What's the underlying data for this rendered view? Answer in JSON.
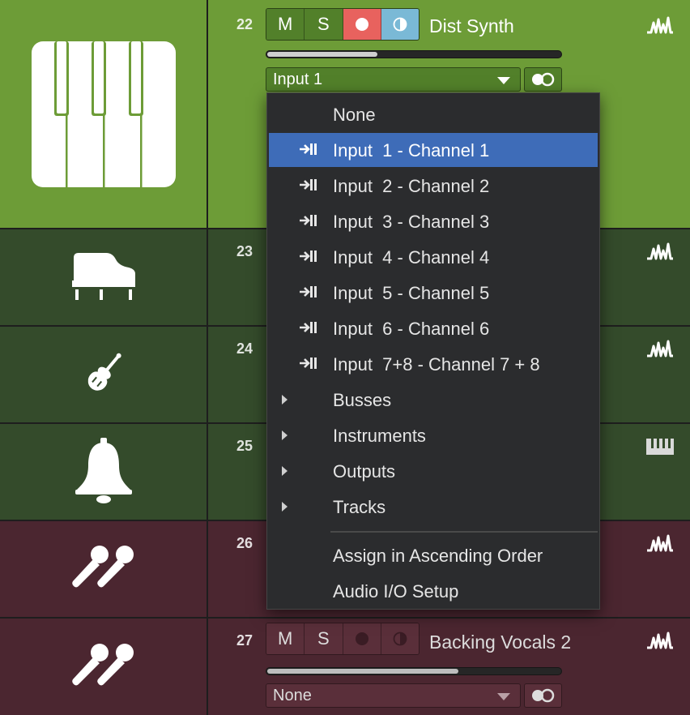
{
  "tracks": [
    {
      "number": "22",
      "name": "Dist Synth",
      "input": "Input  1",
      "icon": "piano-keys-icon",
      "color": "#6d9c37",
      "mute": "M",
      "solo": "S",
      "volume": 0.37
    },
    {
      "number": "23",
      "icon": "grand-piano-icon",
      "color": "#344b2b"
    },
    {
      "number": "24",
      "icon": "violin-icon",
      "color": "#344b2b"
    },
    {
      "number": "25",
      "icon": "bell-icon",
      "color": "#344b2b"
    },
    {
      "number": "26",
      "icon": "microphones-icon",
      "color": "#4b2630"
    },
    {
      "number": "27",
      "name": "Backing Vocals 2",
      "input": "None",
      "icon": "microphones-icon",
      "color": "#4b2630",
      "mute": "M",
      "solo": "S",
      "volume": 0.65
    }
  ],
  "menu": {
    "none_label": "None",
    "inputs": [
      "Input  1 - Channel 1",
      "Input  2 - Channel 2",
      "Input  3 - Channel 3",
      "Input  4 - Channel 4",
      "Input  5 - Channel 5",
      "Input  6 - Channel 6",
      "Input  7+8 - Channel 7 + 8"
    ],
    "submenus": [
      "Busses",
      "Instruments",
      "Outputs",
      "Tracks"
    ],
    "actions": [
      "Assign in Ascending Order",
      "Audio I/O Setup"
    ],
    "highlighted_index": 0,
    "highlight_color": "#3e6cb8"
  },
  "colors": {
    "record": "#e8625e",
    "monitor": "#7ab9d6",
    "instrument_green": "#6d9c37",
    "audio_green": "#344b2b",
    "vocal_maroon": "#4b2630"
  }
}
